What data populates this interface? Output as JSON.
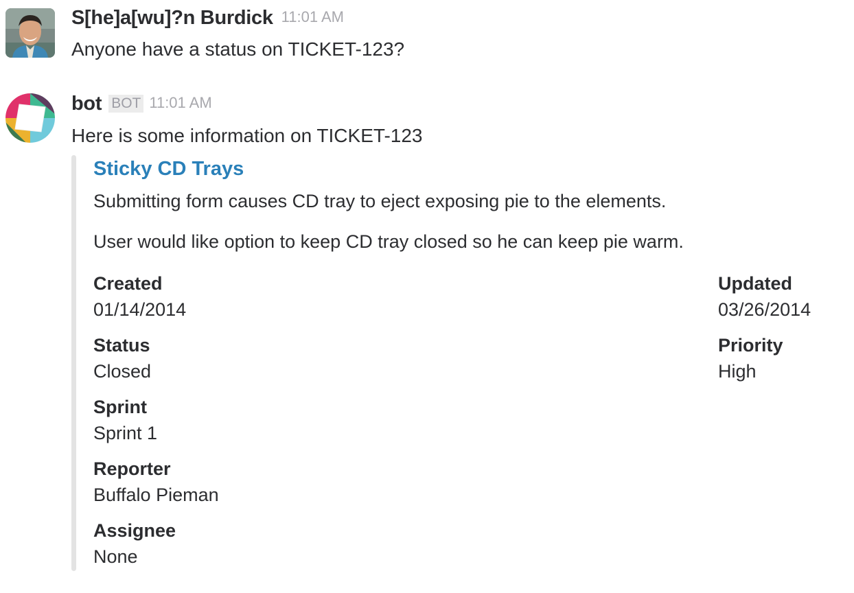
{
  "messages": [
    {
      "author": "S[he]a[wu]?n Burdick",
      "time": "11:01 AM",
      "text": "Anyone have a status on TICKET-123?"
    },
    {
      "author": "bot",
      "badge": "BOT",
      "time": "11:01 AM",
      "text": "Here is some information on TICKET-123",
      "attachment": {
        "title": "Sticky CD Trays",
        "paragraph1": "Submitting form causes CD tray to eject exposing pie to the elements.",
        "paragraph2": "User would like option to keep CD tray closed so he can keep pie warm.",
        "fields": {
          "created": {
            "label": "Created",
            "value": "01/14/2014"
          },
          "updated": {
            "label": "Updated",
            "value": "03/26/2014"
          },
          "status": {
            "label": "Status",
            "value": "Closed"
          },
          "priority": {
            "label": "Priority",
            "value": "High"
          },
          "sprint": {
            "label": "Sprint",
            "value": "Sprint 1"
          },
          "reporter": {
            "label": "Reporter",
            "value": "Buffalo Pieman"
          },
          "assignee": {
            "label": "Assignee",
            "value": "None"
          }
        },
        "bar_color": "#e3e3e3",
        "title_color": "#2a80b9"
      }
    }
  ],
  "icons": {
    "user_avatar": "user-avatar-photo",
    "bot_avatar": "slack-logo-icon"
  }
}
